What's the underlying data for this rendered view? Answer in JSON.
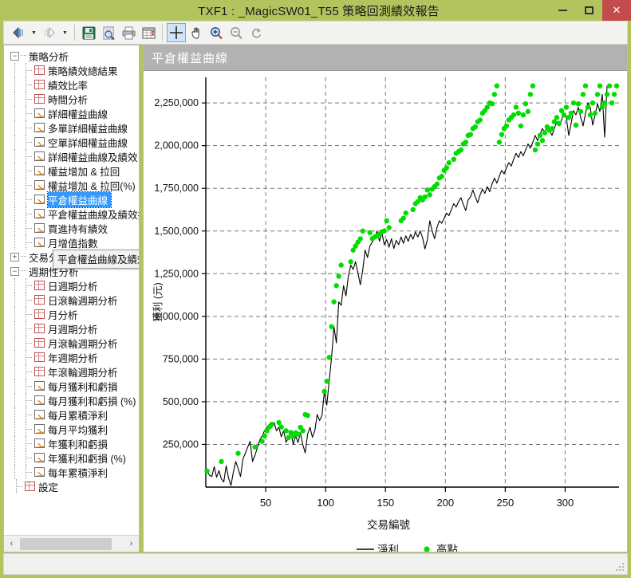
{
  "window": {
    "title": "TXF1 : _MagicSW01_T55 策略回測績效報告",
    "minimize_label": "",
    "maximize_label": "",
    "close_label": "✕"
  },
  "toolbar": {
    "buttons": [
      {
        "name": "nav-back",
        "icon": "back-icon"
      },
      {
        "name": "nav-back-dropdown",
        "icon": "chevron-down-icon"
      },
      {
        "name": "nav-forward",
        "icon": "forward-icon"
      },
      {
        "name": "nav-forward-dropdown",
        "icon": "chevron-down-icon"
      },
      {
        "name": "save",
        "icon": "save-icon"
      },
      {
        "name": "print-preview",
        "icon": "print-preview-icon"
      },
      {
        "name": "print",
        "icon": "print-icon"
      },
      {
        "name": "report",
        "icon": "report-icon"
      },
      {
        "name": "crosshair",
        "icon": "crosshair-icon",
        "active": true
      },
      {
        "name": "pan",
        "icon": "hand-icon"
      },
      {
        "name": "zoom-in",
        "icon": "zoom-in-icon"
      },
      {
        "name": "zoom-out",
        "icon": "zoom-out-icon"
      },
      {
        "name": "reset-zoom",
        "icon": "reset-icon"
      }
    ]
  },
  "sidebar": {
    "tooltip": "平倉權益曲線及績效拉回",
    "scrollbar": {
      "left_arrow": "‹",
      "right_arrow": "›"
    },
    "tree": [
      {
        "label": "策略分析",
        "level": 0,
        "type": "group",
        "expander": "−"
      },
      {
        "label": "策略績效總結果",
        "level": 1,
        "type": "grid"
      },
      {
        "label": "績效比率",
        "level": 1,
        "type": "grid"
      },
      {
        "label": "時間分析",
        "level": 1,
        "type": "grid"
      },
      {
        "label": "詳細權益曲線",
        "level": 1,
        "type": "chart"
      },
      {
        "label": "多單詳細權益曲線",
        "level": 1,
        "type": "chart"
      },
      {
        "label": "空單詳細權益曲線",
        "level": 1,
        "type": "chart"
      },
      {
        "label": "詳細權益曲線及績效",
        "level": 1,
        "type": "chart"
      },
      {
        "label": "權益增加 & 拉回",
        "level": 1,
        "type": "chart"
      },
      {
        "label": "權益增加 & 拉回(%)",
        "level": 1,
        "type": "chart"
      },
      {
        "label": "平倉權益曲線",
        "level": 1,
        "type": "chart",
        "selected": true
      },
      {
        "label": "平倉權益曲線及績效拉回",
        "level": 1,
        "type": "chart",
        "hidden_by_tooltip": true
      },
      {
        "label": "買進持有績效",
        "level": 1,
        "type": "chart"
      },
      {
        "label": "月增值指數",
        "level": 1,
        "type": "chart"
      },
      {
        "label": "交易分析",
        "level": 0,
        "type": "group",
        "expander": "+"
      },
      {
        "label": "週期性分析",
        "level": 0,
        "type": "group",
        "expander": "−"
      },
      {
        "label": "日週期分析",
        "level": 1,
        "type": "grid"
      },
      {
        "label": "日滾輪週期分析",
        "level": 1,
        "type": "grid"
      },
      {
        "label": "月分析",
        "level": 1,
        "type": "grid"
      },
      {
        "label": "月週期分析",
        "level": 1,
        "type": "grid"
      },
      {
        "label": "月滾輪週期分析",
        "level": 1,
        "type": "grid"
      },
      {
        "label": "年週期分析",
        "level": 1,
        "type": "grid"
      },
      {
        "label": "年滾輪週期分析",
        "level": 1,
        "type": "grid"
      },
      {
        "label": "每月獲利和虧損",
        "level": 1,
        "type": "chart"
      },
      {
        "label": "每月獲利和虧損 (%)",
        "level": 1,
        "type": "chart"
      },
      {
        "label": "每月累積淨利",
        "level": 1,
        "type": "chart"
      },
      {
        "label": "每月平均獲利",
        "level": 1,
        "type": "chart"
      },
      {
        "label": "年獲利和虧損",
        "level": 1,
        "type": "chart"
      },
      {
        "label": "年獲利和虧損 (%)",
        "level": 1,
        "type": "chart"
      },
      {
        "label": "每年累積淨利",
        "level": 1,
        "type": "chart"
      },
      {
        "label": "設定",
        "level": 0,
        "type": "grid",
        "leaf": true
      }
    ]
  },
  "chart_panel": {
    "header_title": "平倉權益曲線"
  },
  "chart_data": {
    "type": "line",
    "title": "平倉權益曲線",
    "xlabel": "交易編號",
    "ylabel": "獲利 (元)",
    "xlim": [
      0,
      345
    ],
    "ylim": [
      0,
      2400000
    ],
    "xticks": [
      50,
      100,
      150,
      200,
      250,
      300
    ],
    "yticks": [
      250000,
      500000,
      750000,
      1000000,
      1250000,
      1500000,
      1750000,
      2000000,
      2250000
    ],
    "ytick_labels": [
      "250,000",
      "500,000",
      "750,000",
      "1,000,000",
      "1,250,000",
      "1,500,000",
      "1,750,000",
      "2,000,000",
      "2,250,000"
    ],
    "grid": true,
    "legend_position": "bottom",
    "legend": [
      {
        "name": "淨利",
        "style": "line",
        "color": "#000000"
      },
      {
        "name": "高點",
        "style": "marker",
        "color": "#00dd00"
      }
    ],
    "series": [
      {
        "name": "淨利",
        "color": "#000000",
        "x": [
          1,
          3,
          5,
          7,
          9,
          11,
          13,
          15,
          17,
          19,
          21,
          23,
          25,
          27,
          29,
          31,
          33,
          35,
          37,
          39,
          41,
          43,
          45,
          47,
          49,
          51,
          53,
          55,
          57,
          59,
          61,
          63,
          65,
          67,
          69,
          71,
          73,
          75,
          77,
          79,
          81,
          83,
          85,
          87,
          89,
          91,
          93,
          95,
          97,
          99,
          101,
          103,
          105,
          107,
          109,
          111,
          113,
          115,
          117,
          119,
          121,
          123,
          125,
          127,
          129,
          131,
          133,
          135,
          137,
          139,
          141,
          143,
          145,
          147,
          149,
          151,
          153,
          155,
          157,
          159,
          161,
          163,
          165,
          167,
          169,
          171,
          173,
          175,
          177,
          179,
          181,
          183,
          185,
          187,
          189,
          191,
          193,
          195,
          197,
          199,
          201,
          203,
          205,
          207,
          209,
          211,
          213,
          215,
          217,
          219,
          221,
          223,
          225,
          227,
          229,
          231,
          233,
          235,
          237,
          239,
          241,
          243,
          245,
          247,
          249,
          251,
          253,
          255,
          257,
          259,
          261,
          263,
          265,
          267,
          269,
          271,
          273,
          275,
          277,
          279,
          281,
          283,
          285,
          287,
          289,
          291,
          293,
          295,
          297,
          299,
          301,
          303,
          305,
          307,
          309,
          311,
          313,
          315,
          317,
          319,
          321,
          323,
          325,
          327,
          329,
          331,
          333,
          335,
          337,
          339,
          341,
          343
        ],
        "y": [
          95000,
          70000,
          62000,
          120000,
          58000,
          96000,
          48000,
          30000,
          125000,
          52000,
          10000,
          88000,
          150000,
          108000,
          62000,
          165000,
          198000,
          235000,
          268000,
          150000,
          185000,
          230000,
          275000,
          300000,
          330000,
          352000,
          368000,
          350000,
          378000,
          330000,
          352000,
          295000,
          330000,
          262000,
          290000,
          320000,
          250000,
          300000,
          262000,
          318000,
          248000,
          200000,
          310000,
          350000,
          292000,
          330000,
          425000,
          390000,
          420000,
          560000,
          480000,
          620000,
          760000,
          940000,
          845000,
          1085000,
          1065000,
          1180000,
          1120000,
          1235000,
          1300000,
          1275000,
          1320000,
          1255000,
          1185000,
          1270000,
          1388000,
          1345000,
          1412000,
          1435000,
          1455000,
          1500000,
          1440000,
          1490000,
          1420000,
          1450000,
          1405000,
          1455000,
          1398000,
          1445000,
          1420000,
          1465000,
          1428000,
          1472000,
          1440000,
          1480000,
          1452000,
          1495000,
          1465000,
          1500000,
          1460000,
          1395000,
          1450000,
          1560000,
          1500000,
          1455000,
          1520000,
          1560000,
          1545000,
          1575000,
          1605000,
          1590000,
          1625000,
          1660000,
          1640000,
          1672000,
          1695000,
          1655000,
          1620000,
          1682000,
          1700000,
          1740000,
          1700000,
          1665000,
          1712000,
          1745000,
          1720000,
          1760000,
          1730000,
          1775000,
          1810000,
          1780000,
          1820000,
          1855000,
          1835000,
          1870000,
          1900000,
          1880000,
          1920000,
          1955000,
          1930000,
          1965000,
          1940000,
          1975000,
          2010000,
          1985000,
          2020000,
          2060000,
          2030000,
          2065000,
          2100000,
          2075000,
          2110000,
          2090000,
          2060000,
          2100000,
          2140000,
          2115000,
          2150000,
          2190000,
          2165000,
          2060000,
          2130000,
          2205000,
          2180000,
          2225000,
          2165000,
          2115000,
          2190000,
          2250000,
          2225000,
          2120000,
          2180000,
          2245000,
          2200000,
          2300000,
          2050000,
          2350000
        ]
      },
      {
        "name": "高點",
        "color": "#00dd00",
        "style": "scatter",
        "x": [
          1,
          13,
          27,
          41,
          47,
          49,
          51,
          53,
          55,
          61,
          63,
          67,
          69,
          71,
          73,
          75,
          77,
          79,
          81,
          83,
          85,
          99,
          101,
          103,
          105,
          107,
          109,
          111,
          113,
          121,
          123,
          125,
          127,
          129,
          131,
          137,
          139,
          141,
          143,
          145,
          147,
          149,
          151,
          153,
          163,
          165,
          167,
          173,
          175,
          177,
          179,
          181,
          183,
          185,
          187,
          189,
          191,
          193,
          195,
          197,
          199,
          201,
          203,
          207,
          209,
          211,
          213,
          215,
          217,
          219,
          221,
          223,
          225,
          227,
          229,
          231,
          233,
          235,
          237,
          239,
          241,
          243,
          245,
          247,
          249,
          251,
          253,
          255,
          257,
          259,
          261,
          263,
          265,
          267,
          269,
          271,
          273,
          275,
          277,
          279,
          281,
          283,
          285,
          287,
          289,
          291,
          293,
          295,
          297,
          299,
          301,
          303,
          305,
          307,
          309,
          311,
          313,
          315,
          317,
          319,
          321,
          323,
          325,
          327,
          329,
          331,
          333,
          335,
          337,
          339,
          341,
          343
        ],
        "y": [
          95000,
          150000,
          198000,
          235000,
          268000,
          300000,
          330000,
          352000,
          368000,
          378000,
          352000,
          330000,
          290000,
          320000,
          300000,
          318000,
          310000,
          350000,
          330000,
          425000,
          420000,
          560000,
          620000,
          760000,
          940000,
          1085000,
          1180000,
          1235000,
          1300000,
          1320000,
          1388000,
          1412000,
          1435000,
          1455000,
          1500000,
          1490000,
          1455000,
          1465000,
          1472000,
          1480000,
          1495000,
          1500000,
          1560000,
          1520000,
          1560000,
          1575000,
          1605000,
          1625000,
          1660000,
          1672000,
          1695000,
          1682000,
          1700000,
          1740000,
          1712000,
          1745000,
          1760000,
          1775000,
          1810000,
          1820000,
          1855000,
          1870000,
          1900000,
          1920000,
          1955000,
          1965000,
          1975000,
          2010000,
          2020000,
          2060000,
          2065000,
          2100000,
          2110000,
          2140000,
          2150000,
          2190000,
          2205000,
          2225000,
          2250000,
          2245000,
          2300000,
          2350000,
          2020000,
          2065000,
          2100000,
          2115000,
          2150000,
          2165000,
          2180000,
          2225000,
          2190000,
          2115000,
          2180000,
          2245000,
          2200000,
          2300000,
          2350000,
          1975000,
          2010000,
          2060000,
          2030000,
          2075000,
          2110000,
          2090000,
          2100000,
          2140000,
          2165000,
          2130000,
          2205000,
          2180000,
          2225000,
          2165000,
          2190000,
          2250000,
          2120000,
          2245000,
          2200000,
          2300000,
          2350000,
          2225000,
          2180000,
          2250000,
          2190000,
          2300000,
          2350000,
          2225000,
          2250000,
          2300000,
          2350000,
          2250000,
          2300000,
          2350000,
          2300000
        ]
      }
    ]
  }
}
